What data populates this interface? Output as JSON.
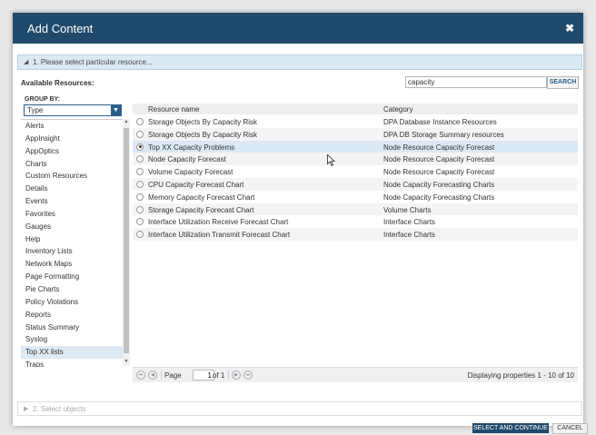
{
  "dialog": {
    "title": "Add Content",
    "close_glyph": "✖"
  },
  "step1": {
    "label": "1. Please select particular resource..."
  },
  "available_label": "Available Resources:",
  "search": {
    "value": "capacity",
    "button": "SEARCH"
  },
  "group_by": {
    "label": "GROUP BY:",
    "selected": "Type",
    "items": [
      "Alerts",
      "AppInsight",
      "AppOptics",
      "Charts",
      "Custom Resources",
      "Details",
      "Events",
      "Favorites",
      "Gauges",
      "Help",
      "Inventory Lists",
      "Network Maps",
      "Page Formatting",
      "Pie Charts",
      "Policy Violations",
      "Reports",
      "Status Summary",
      "Syslog",
      "Top XX lists",
      "Traps"
    ],
    "selected_item": "Top XX lists"
  },
  "table": {
    "columns": [
      "Resource name",
      "Category"
    ],
    "rows": [
      {
        "name": "Storage Objects By Capacity Risk",
        "category": "DPA Database Instance Resources",
        "checked": false
      },
      {
        "name": "Storage Objects By Capacity Risk",
        "category": "DPA DB Storage Summary resources",
        "checked": false
      },
      {
        "name": "Top XX Capacity Problems",
        "category": "Node Resource Capacity Forecast",
        "checked": true
      },
      {
        "name": "Node Capacity Forecast",
        "category": "Node Resource Capacity Forecast",
        "checked": false
      },
      {
        "name": "Volume Capacity Forecast",
        "category": "Node Resource Capacity Forecast",
        "checked": false
      },
      {
        "name": "CPU Capacity Forecast Chart",
        "category": "Node Capacity Forecasting Charts",
        "checked": false
      },
      {
        "name": "Memory Capacity Forecast Chart",
        "category": "Node Capacity Forecasting Charts",
        "checked": false
      },
      {
        "name": "Storage Capacity Forecast Chart",
        "category": "Volume Charts",
        "checked": false
      },
      {
        "name": "Interface Utilization Receive Forecast Chart",
        "category": "Interface Charts",
        "checked": false
      },
      {
        "name": "Interface Utilization Transmit Forecast Chart",
        "category": "Interface Charts",
        "checked": false
      }
    ]
  },
  "pager": {
    "page_label": "Page",
    "page_value": "1",
    "of_label": "of 1",
    "displaying": "Displaying properties 1 - 10 of 10"
  },
  "step2": {
    "label": "2. Select objects"
  },
  "buttons": {
    "primary": "SELECT AND CONTINUE",
    "cancel": "CANCEL"
  },
  "colors": {
    "titlebar": "#204a6b",
    "selected_row": "#dbe9f5",
    "step_bar": "#dbe9f3"
  }
}
